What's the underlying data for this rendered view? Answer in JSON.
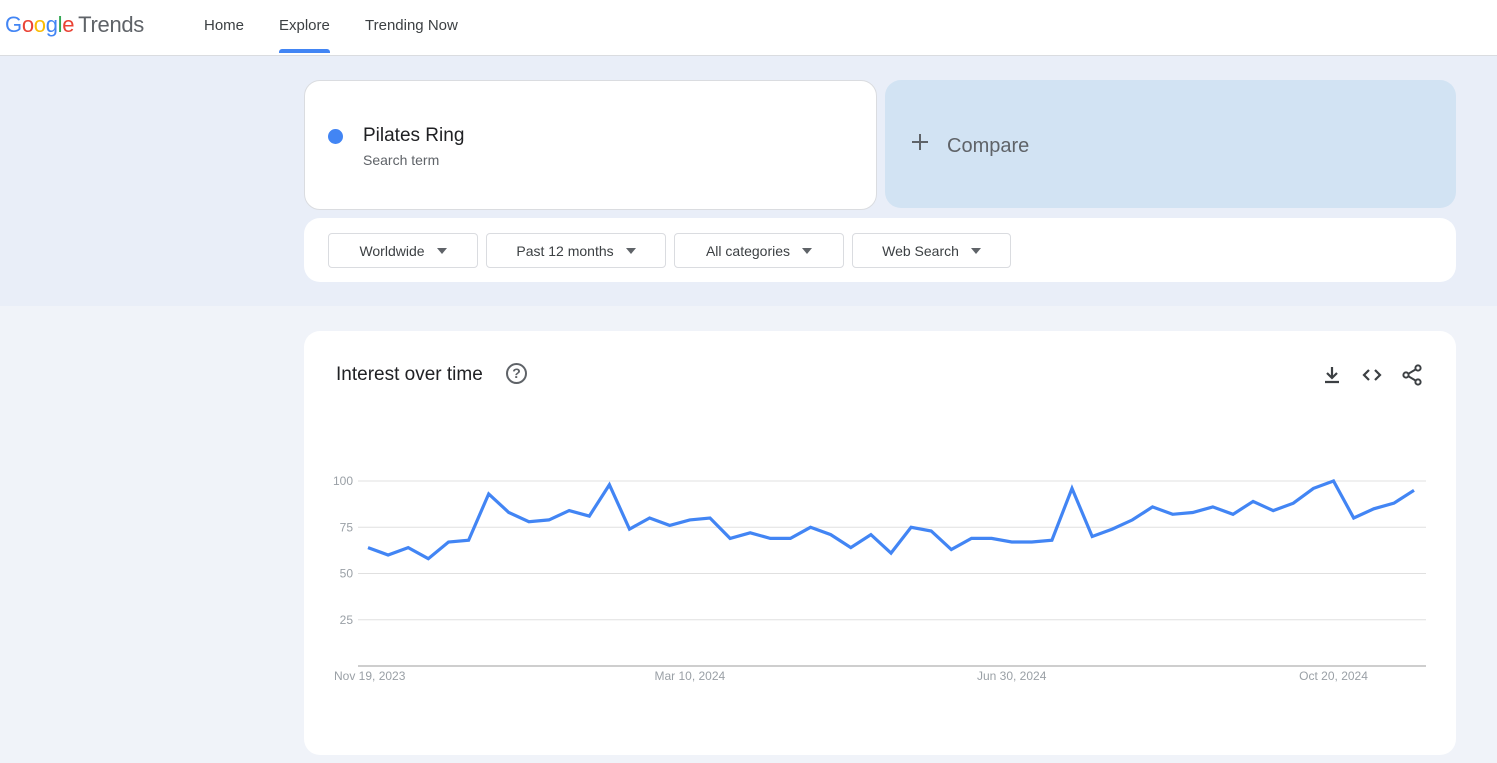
{
  "header": {
    "logo": {
      "google": [
        "G",
        "o",
        "o",
        "g",
        "l",
        "e"
      ],
      "product": "Trends"
    },
    "nav": [
      {
        "label": "Home",
        "active": false
      },
      {
        "label": "Explore",
        "active": true
      },
      {
        "label": "Trending Now",
        "active": false
      }
    ]
  },
  "search": {
    "term": "Pilates Ring",
    "term_type": "Search term",
    "term_color": "#4285f4",
    "compare_label": "Compare",
    "compare_icon": "plus-icon"
  },
  "filters": [
    {
      "label": "Worldwide"
    },
    {
      "label": "Past 12 months"
    },
    {
      "label": "All categories"
    },
    {
      "label": "Web Search"
    }
  ],
  "interest_card": {
    "title": "Interest over time",
    "help_icon": "help-circle-icon",
    "actions": [
      "download-icon",
      "embed-code-icon",
      "share-icon"
    ]
  },
  "chart_data": {
    "type": "line",
    "title": "Interest over time",
    "xlabel": "",
    "ylabel": "",
    "ylim": [
      0,
      100
    ],
    "yticks": [
      25,
      50,
      75,
      100
    ],
    "grid": true,
    "x_start": "Nov 19, 2023",
    "x_interval": "weekly",
    "xtick_labels": [
      {
        "label": "Nov 19, 2023",
        "index": 0
      },
      {
        "label": "Mar 10, 2024",
        "index": 16
      },
      {
        "label": "Jun 30, 2024",
        "index": 32
      },
      {
        "label": "Oct 20, 2024",
        "index": 48
      }
    ],
    "series": [
      {
        "name": "Pilates Ring",
        "color": "#4285f4",
        "values": [
          64,
          60,
          64,
          58,
          67,
          68,
          93,
          83,
          78,
          79,
          84,
          81,
          98,
          74,
          80,
          76,
          79,
          80,
          69,
          72,
          69,
          69,
          75,
          71,
          64,
          71,
          61,
          75,
          73,
          63,
          69,
          69,
          67,
          67,
          68,
          96,
          70,
          74,
          79,
          86,
          82,
          83,
          86,
          82,
          89,
          84,
          88,
          96,
          100,
          80,
          85,
          88,
          95
        ]
      }
    ]
  }
}
